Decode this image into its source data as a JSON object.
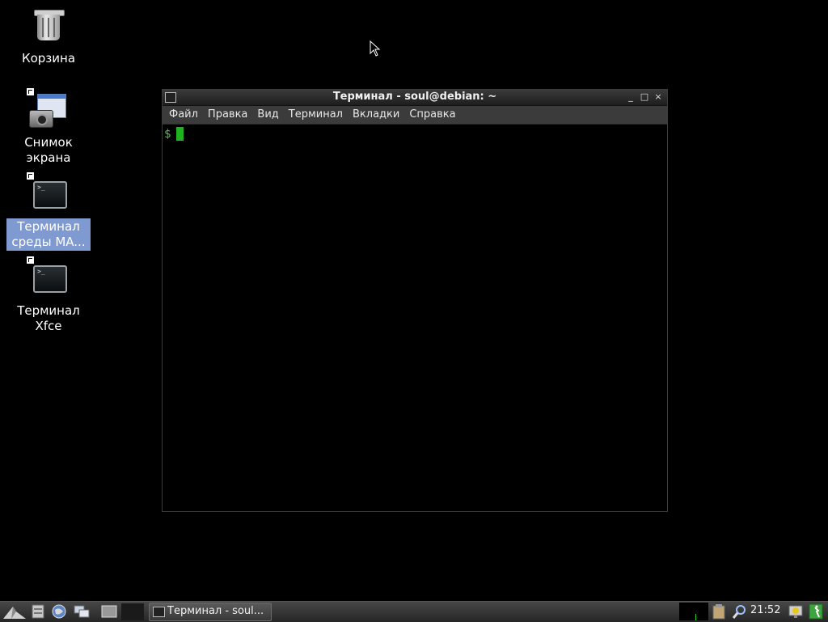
{
  "desktop": {
    "icons": [
      {
        "label": "Корзина"
      },
      {
        "label": "Снимок экрана"
      },
      {
        "label": "Терминал среды MA..."
      },
      {
        "label": "Терминал Xfce"
      }
    ]
  },
  "window": {
    "title": "Терминал - soul@debian: ~",
    "controls": {
      "minimize": "_",
      "maximize": "□",
      "close": "×"
    },
    "menu": [
      "Файл",
      "Правка",
      "Вид",
      "Терминал",
      "Вкладки",
      "Справка"
    ],
    "prompt": "$"
  },
  "taskbar": {
    "task_label": "Терминал - soul...",
    "clock": "21:52"
  },
  "colors": {
    "desktop_bg": "#000000",
    "prompt_green": "#3ad13a",
    "selection_bg": "#7e9ad0"
  }
}
